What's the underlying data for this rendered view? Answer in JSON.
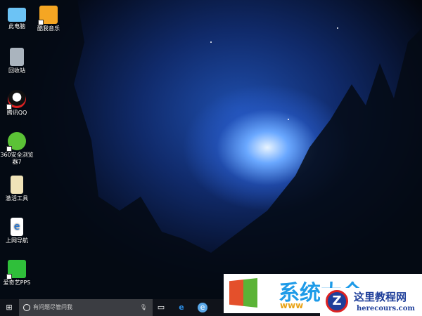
{
  "desktop_icons": [
    {
      "label": "此电脑",
      "icon": "computer-icon"
    },
    {
      "label": "酷我音乐",
      "icon": "kuwo-music-icon"
    },
    {
      "label": "回收站",
      "icon": "recycle-bin-icon"
    },
    {
      "label": "腾讯QQ",
      "icon": "qq-icon"
    },
    {
      "label": "360安全浏览器7",
      "icon": "360-browser-icon"
    },
    {
      "label": "激活工具",
      "icon": "file-icon"
    },
    {
      "label": "上网导航",
      "icon": "ie-file-icon"
    },
    {
      "label": "爱奇艺PPS",
      "icon": "iqiyi-icon"
    }
  ],
  "taskbar": {
    "search_placeholder": "有问题尽管问我"
  },
  "watermarks": {
    "brand1": "系统大全",
    "brand1_url": "www",
    "brand2": "这里教程网",
    "brand2_url": "herecours.com"
  }
}
